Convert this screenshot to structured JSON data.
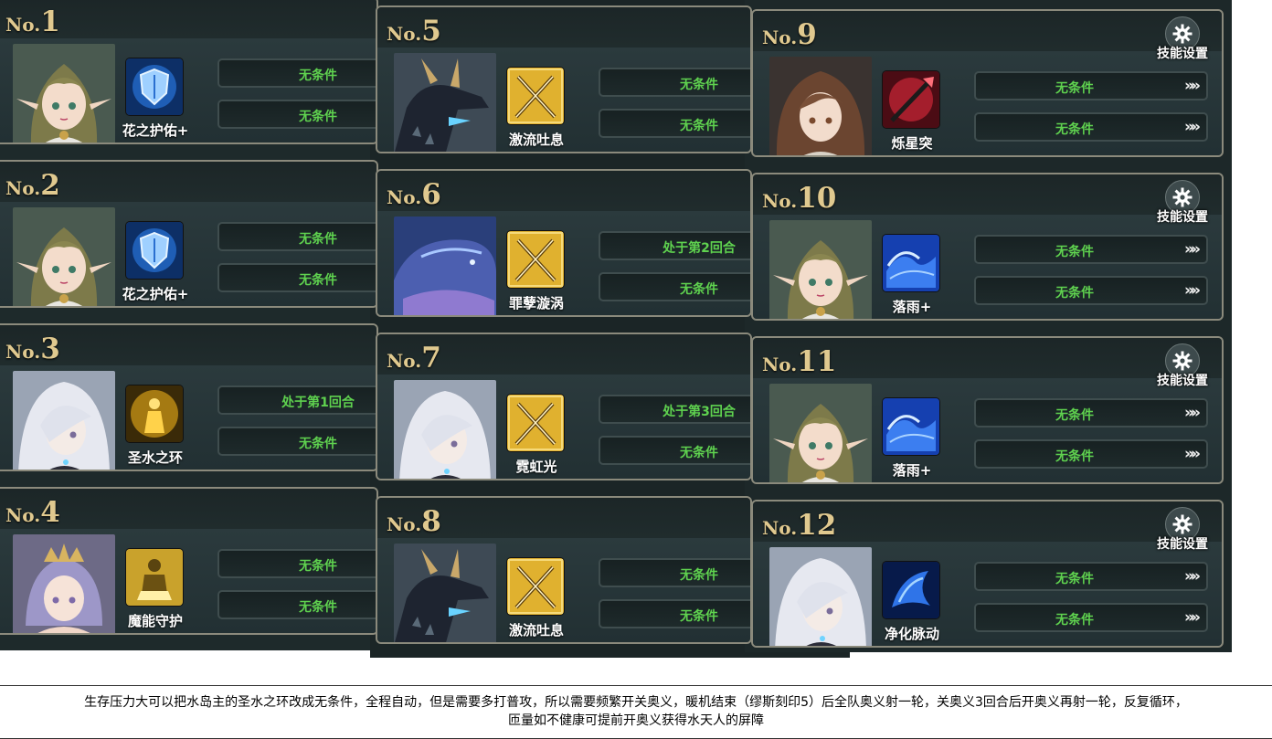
{
  "gear_label": "技能设置",
  "arrows": "»»",
  "slots": [
    {
      "pre": "No.",
      "num": "1",
      "skill": "花之护佑+",
      "cond1": "无条件",
      "cond2": "无条件",
      "portrait": "elf",
      "icon": "shield"
    },
    {
      "pre": "No.",
      "num": "2",
      "skill": "花之护佑+",
      "cond1": "无条件",
      "cond2": "无条件",
      "portrait": "elf",
      "icon": "shield"
    },
    {
      "pre": "No.",
      "num": "3",
      "skill": "圣水之环",
      "cond1": "处于第1回合",
      "cond2": "无条件",
      "portrait": "silver",
      "icon": "golden-figure"
    },
    {
      "pre": "No.",
      "num": "4",
      "skill": "魔能守护",
      "cond1": "无条件",
      "cond2": "无条件",
      "portrait": "violet",
      "icon": "golden-guard"
    },
    {
      "pre": "No.",
      "num": "5",
      "skill": "激流吐息",
      "cond1": "无条件",
      "cond2": "无条件",
      "portrait": "dragon",
      "icon": "swords"
    },
    {
      "pre": "No.",
      "num": "6",
      "skill": "罪孽漩涡",
      "cond1": "处于第2回合",
      "cond2": "无条件",
      "portrait": "whale",
      "icon": "swords"
    },
    {
      "pre": "No.",
      "num": "7",
      "skill": "霓虹光",
      "cond1": "处于第3回合",
      "cond2": "无条件",
      "portrait": "silver",
      "icon": "swords"
    },
    {
      "pre": "No.",
      "num": "8",
      "skill": "激流吐息",
      "cond1": "无条件",
      "cond2": "无条件",
      "portrait": "dragon",
      "icon": "swords"
    },
    {
      "pre": "No.",
      "num": "9",
      "skill": "烁星突",
      "cond1": "无条件",
      "cond2": "无条件",
      "portrait": "brown",
      "icon": "spear"
    },
    {
      "pre": "No.",
      "num": "10",
      "skill": "落雨+",
      "cond1": "无条件",
      "cond2": "无条件",
      "portrait": "elf",
      "icon": "wave"
    },
    {
      "pre": "No.",
      "num": "11",
      "skill": "落雨+",
      "cond1": "无条件",
      "cond2": "无条件",
      "portrait": "elf",
      "icon": "wave"
    },
    {
      "pre": "No.",
      "num": "12",
      "skill": "净化脉动",
      "cond1": "无条件",
      "cond2": "无条件",
      "portrait": "silver",
      "icon": "splash"
    }
  ],
  "notes": {
    "line1": "生存压力大可以把水岛主的圣水之环改成无条件，全程自动，但是需要多打普攻，所以需要频繁开关奥义，暖机结束（缪斯刻印5）后全队奥义射一轮，关奥义3回合后开奥义再射一轮，反复循环，",
    "line2": "匝量如不健康可提前开奥义获得水天人的屏障"
  }
}
